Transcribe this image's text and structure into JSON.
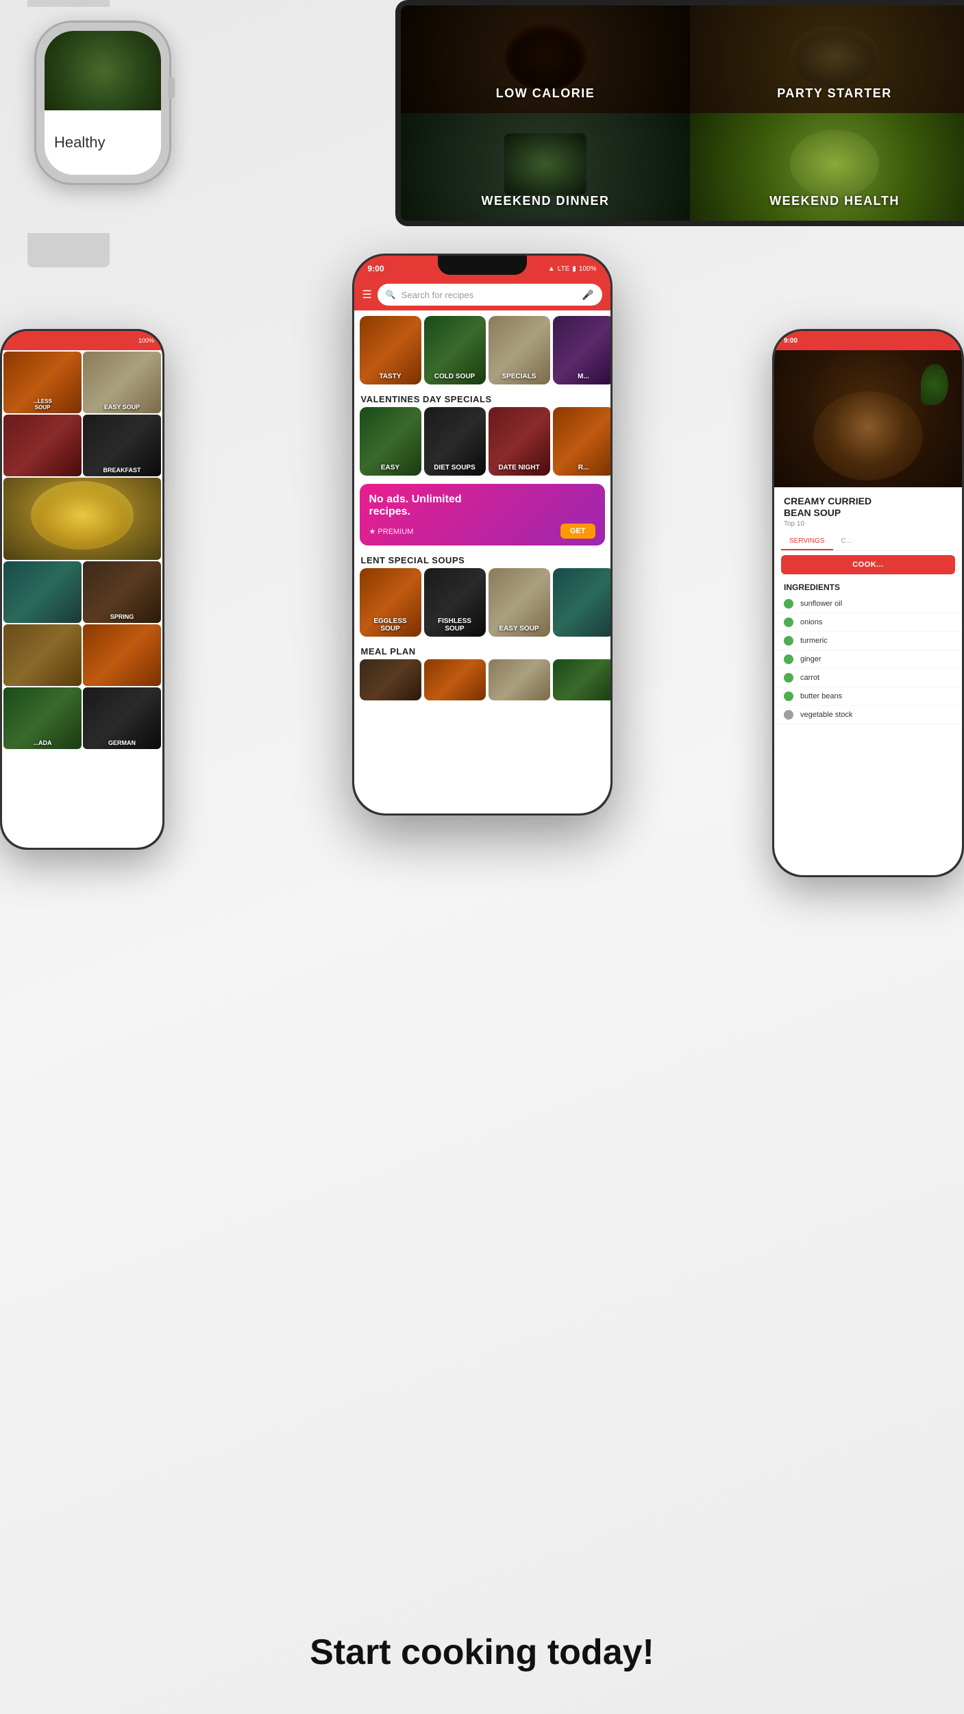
{
  "page": {
    "background_color": "#f0f0f0",
    "bottom_cta": "Start cooking today!"
  },
  "watch": {
    "label": "Healthy"
  },
  "tablet": {
    "categories": [
      {
        "label": "LOW CALORIE"
      },
      {
        "label": "PARTY STARTER"
      },
      {
        "label": "WEEKEND DINNER"
      },
      {
        "label": "WEEKEND HEALTH"
      }
    ]
  },
  "phone_main": {
    "status_bar": {
      "time": "9:00",
      "signal": "LTE",
      "battery": "100%"
    },
    "search_placeholder": "Search for recipes",
    "categories": [
      {
        "label": "TASTY"
      },
      {
        "label": "COLD SOUP"
      },
      {
        "label": "SPECIALS"
      },
      {
        "label": "M..."
      }
    ],
    "valentines_section": {
      "title": "VALENTINES DAY SPECIALS",
      "items": [
        {
          "label": "EASY"
        },
        {
          "label": "DIET SOUPS"
        },
        {
          "label": "DATE NIGHT"
        },
        {
          "label": "R..."
        }
      ]
    },
    "premium": {
      "text": "No ads. Unlimited\nrecipes.",
      "badge": "★ PREMIUM",
      "button": "GET"
    },
    "lent_section": {
      "title": "LENT SPECIAL SOUPS",
      "items": [
        {
          "label": "EGGLESS\nSOUP"
        },
        {
          "label": "FISHLESS\nSOUP"
        },
        {
          "label": "EASY SOUP"
        }
      ]
    },
    "meal_plan": {
      "title": "MEAL PLAN"
    }
  },
  "phone_left": {
    "status_battery": "100%",
    "cells": [
      {
        "label": "...LESS\nSOUP"
      },
      {
        "label": "EASY SOUP"
      },
      {
        "label": ""
      },
      {
        "label": "BREAKFAST"
      },
      {
        "label": ""
      },
      {
        "label": ""
      },
      {
        "label": ""
      },
      {
        "label": "SPRING"
      },
      {
        "label": ""
      },
      {
        "label": ""
      },
      {
        "label": "...ADA"
      },
      {
        "label": "GERMAN"
      }
    ]
  },
  "phone_right": {
    "status_time": "9:00",
    "recipe_title": "CREAMY CURRIED\nBEAN SOUP",
    "recipe_sub": "Top 10",
    "tab_servings": "SERVINGS",
    "tab_cook": "C...",
    "cook_button": "COOK...",
    "ingredients_title": "INGREDIENTS",
    "ingredients": [
      {
        "name": "sunflower oil",
        "color": "#4CAF50"
      },
      {
        "name": "onions",
        "color": "#4CAF50"
      },
      {
        "name": "turmeric",
        "color": "#4CAF50"
      },
      {
        "name": "ginger",
        "color": "#4CAF50"
      },
      {
        "name": "carrot",
        "color": "#4CAF50"
      },
      {
        "name": "butter beans",
        "color": "#4CAF50"
      },
      {
        "name": "vegetable stock",
        "color": "#9E9E9E"
      }
    ]
  }
}
